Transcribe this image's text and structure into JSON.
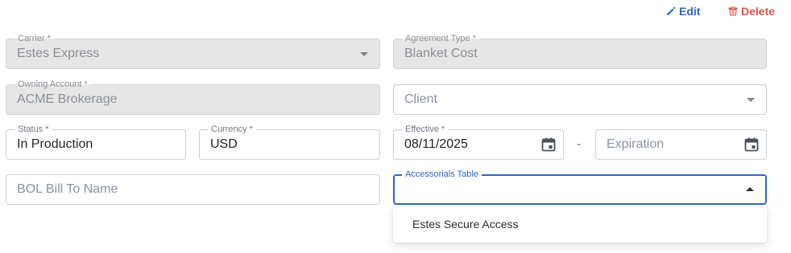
{
  "actions": {
    "edit_label": "Edit",
    "delete_label": "Delete"
  },
  "form": {
    "carrier": {
      "label": "Carrier *",
      "value": "Estes Express"
    },
    "agreement_type": {
      "label": "Agreement Type *",
      "value": "Blanket Cost"
    },
    "owning_account": {
      "label": "Owning Account *",
      "value": "ACME Brokerage"
    },
    "client": {
      "placeholder": "Client"
    },
    "status": {
      "label": "Status *",
      "value": "In Production"
    },
    "currency": {
      "label": "Currency *",
      "value": "USD"
    },
    "effective": {
      "label": "Effective *",
      "value": "08/11/2025"
    },
    "range_separator": "-",
    "expiration": {
      "placeholder": "Expiration"
    },
    "bol_bill_to": {
      "placeholder": "BOL Bill To Name"
    },
    "accessorials_table": {
      "label": "Accessorials Table",
      "value": ""
    }
  },
  "dropdown": {
    "options": [
      "Estes Secure Access"
    ]
  },
  "colors": {
    "accent": "#2e66c7",
    "danger": "#d9534f",
    "disabled_bg": "#e6e6e6"
  },
  "icons": {
    "edit": "pencil-icon",
    "delete": "trash-icon",
    "date": "calendar-icon",
    "select": "chevron-down-icon"
  }
}
